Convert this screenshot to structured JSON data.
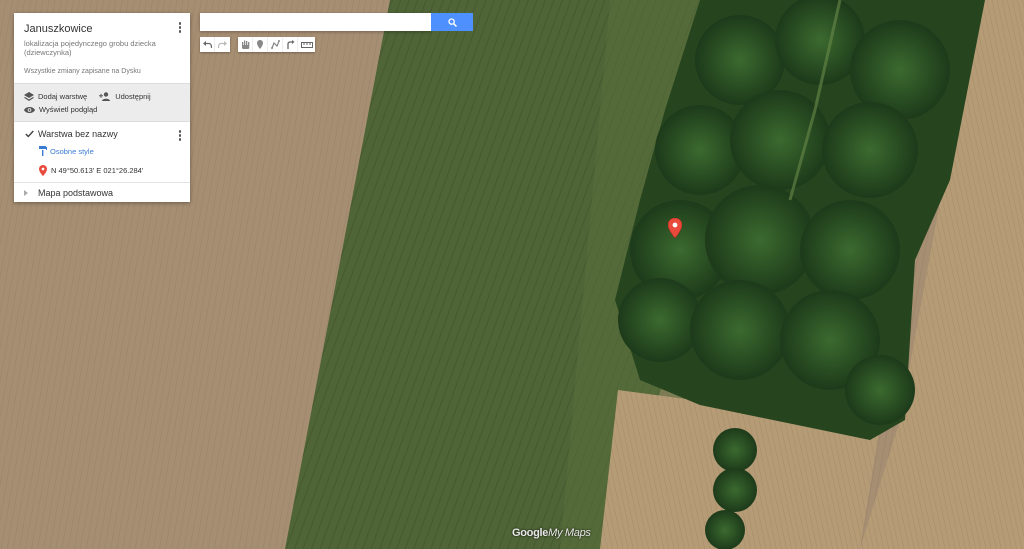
{
  "map": {
    "type": "satellite",
    "marker_color": "#e84b3c"
  },
  "panel": {
    "title": "Januszkowice",
    "description": "lokalizacja pojedynczego grobu dziecka (dziewczynka)",
    "saved_status": "Wszystkie zmiany zapisane na Dysku",
    "actions": {
      "add_layer": "Dodaj warstwę",
      "share": "Udostępnij",
      "preview": "Wyświetl podgląd"
    },
    "layer": {
      "name": "Warstwa bez nazwy",
      "checked": true,
      "style_label": "Osobne style",
      "place": "N 49°50.613' E 021°26.284'"
    },
    "base_map_label": "Mapa podstawowa"
  },
  "search": {
    "value": "",
    "placeholder": ""
  },
  "toolbar": {
    "icons": [
      "undo-icon",
      "redo-icon",
      "hand-icon",
      "add-marker-icon",
      "draw-line-icon",
      "directions-icon",
      "measure-icon"
    ]
  },
  "branding": {
    "google": "Google",
    "mymaps": "My Maps"
  },
  "colors": {
    "accent": "#4d90fe",
    "link": "#3a7bd5"
  }
}
